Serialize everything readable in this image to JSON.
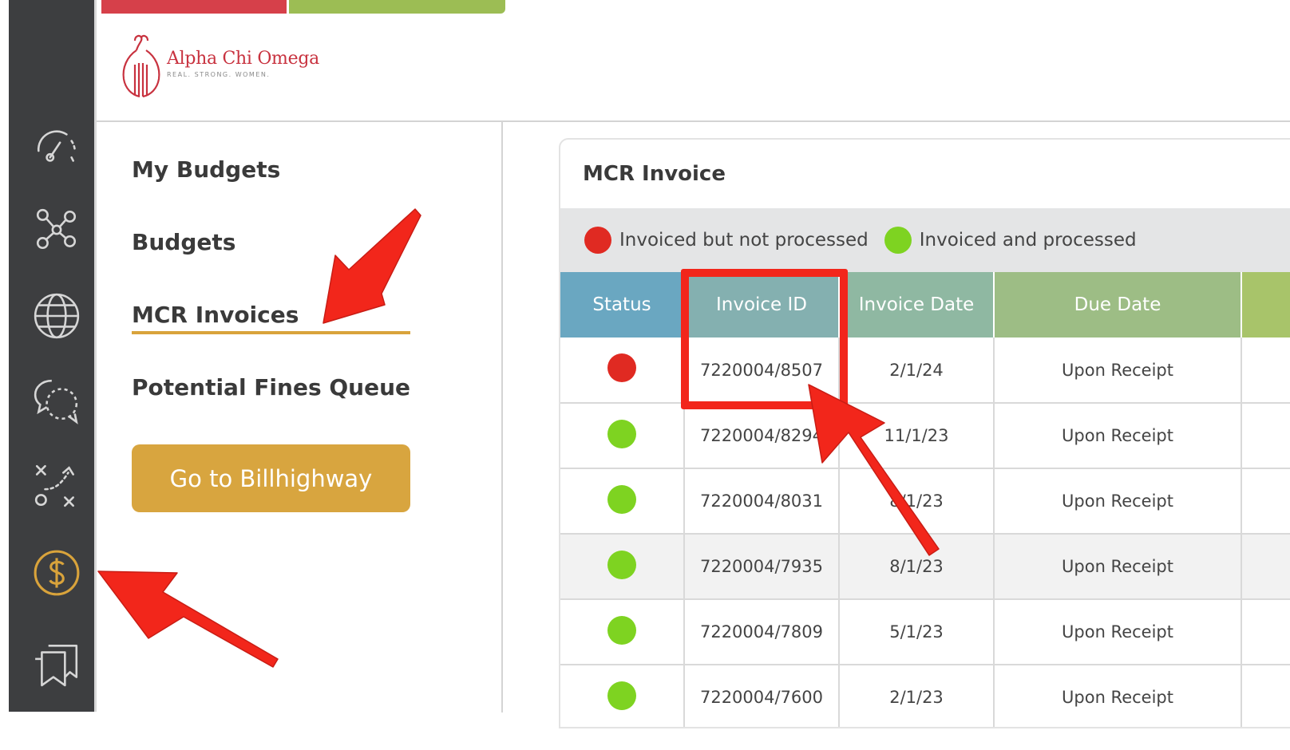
{
  "brand": {
    "name": "Alpha Chi Omega",
    "tagline": "REAL. STRONG. WOMEN.",
    "logo_icon": "lyre-logo-icon",
    "color": "#c8323f"
  },
  "rail": {
    "icons": [
      "speedometer-icon",
      "network-icon",
      "globe-icon",
      "chat-bubbles-icon",
      "strategy-play-icon",
      "dollar-circle-icon",
      "bookmarks-icon"
    ],
    "active": "dollar-circle-icon",
    "active_color": "#d9a33b"
  },
  "nav": {
    "items": [
      {
        "label": "My Budgets"
      },
      {
        "label": "Budgets"
      },
      {
        "label": "MCR Invoices",
        "active": true
      },
      {
        "label": "Potential Fines Queue"
      }
    ],
    "button_label": "Go to Billhighway"
  },
  "invoice": {
    "title": "MCR Invoice",
    "legend": [
      {
        "label": "Invoiced but not processed",
        "color": "#e02a22"
      },
      {
        "label": "Invoiced and processed",
        "color": "#7ed321"
      }
    ],
    "columns": [
      "Status",
      "Invoice ID",
      "Invoice Date",
      "Due Date"
    ],
    "rows": [
      {
        "status": "not-processed",
        "id": "7220004/8507",
        "date": "2/1/24",
        "due": "Upon Receipt"
      },
      {
        "status": "processed",
        "id": "7220004/8294",
        "date": "11/1/23",
        "due": "Upon Receipt"
      },
      {
        "status": "processed",
        "id": "7220004/8031",
        "date": "8/1/23",
        "due": "Upon Receipt"
      },
      {
        "status": "processed",
        "id": "7220004/7935",
        "date": "8/1/23",
        "due": "Upon Receipt"
      },
      {
        "status": "processed",
        "id": "7220004/7809",
        "date": "5/1/23",
        "due": "Upon Receipt"
      },
      {
        "status": "processed",
        "id": "7220004/7600",
        "date": "2/1/23",
        "due": "Upon Receipt"
      }
    ]
  },
  "colors": {
    "rail_bg": "#3d3e40",
    "accent": "#d9a33b",
    "status_header": "#6aa7c1",
    "invoice_id_header": "#84b0b0",
    "invoice_date_header": "#8fb8a2",
    "due_date_header": "#9dbd85",
    "annotation": "#f2261b"
  }
}
